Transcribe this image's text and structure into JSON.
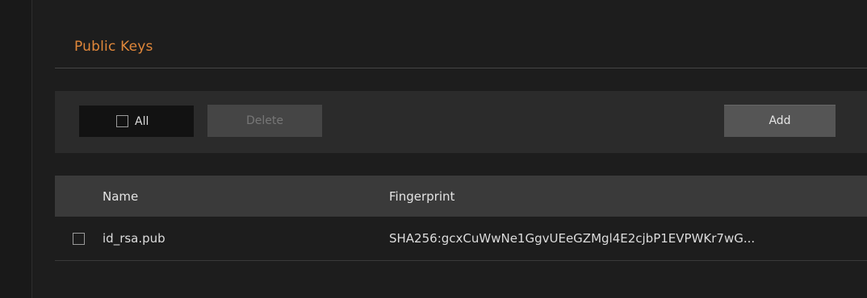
{
  "section": {
    "title": "Public Keys"
  },
  "toolbar": {
    "select_all_label": "All",
    "delete_label": "Delete",
    "add_label": "Add"
  },
  "table": {
    "columns": [
      "Name",
      "Fingerprint"
    ],
    "rows": [
      {
        "name": "id_rsa.pub",
        "fingerprint": "SHA256:gcxCuWwNe1GgvUEeGZMgl4E2cjbP1EVPWKr7wG..."
      }
    ]
  },
  "colors": {
    "accent": "#e0873a",
    "background": "#1d1d1d",
    "toolbar": "#2b2b2b",
    "header": "#3a3a3a"
  }
}
